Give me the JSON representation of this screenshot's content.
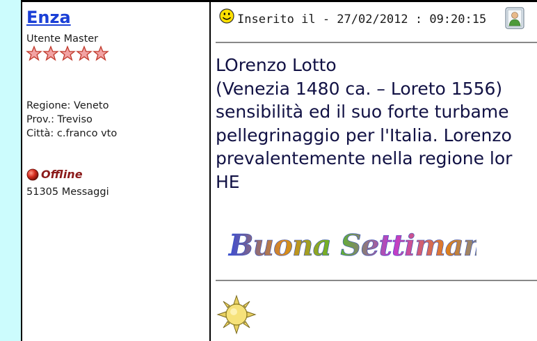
{
  "author": {
    "name": "Enza",
    "rank": "Utente Master",
    "stars": 5,
    "region": "Regione: Veneto",
    "province": "Prov.: Treviso",
    "city": "Città: c.franco vto",
    "status": "Offline",
    "messages": "51305 Messaggi"
  },
  "post": {
    "date_line": "Inserito il - 27/02/2012 : 09:20:15",
    "body_lines": [
      "LOrenzo Lotto",
      "(Venezia 1480 ca. – Loreto 1556)",
      "sensibilità ed il suo forte turbame",
      "pellegrinaggio per l'Italia. Lorenzo",
      "prevalentemente nella regione lor",
      "HE"
    ],
    "banner_text": "Buona Settimana"
  },
  "colors": {
    "page_bg": "#ccfcfd",
    "author_link": "#1a3fd6",
    "offline": "#8b1a1a",
    "body_text": "#111144"
  },
  "icons": {
    "smiley": "smiley-icon",
    "profile": "profile-icon",
    "offline": "offline-dot-icon",
    "star": "rank-star-icon",
    "sun": "sun-icon"
  }
}
